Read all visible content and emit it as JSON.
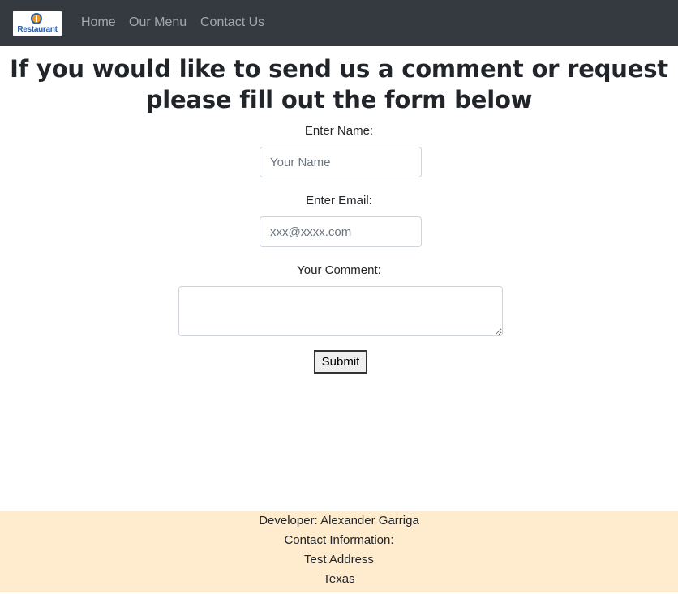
{
  "navbar": {
    "logo_text": "Restaurant",
    "links": [
      {
        "label": "Home"
      },
      {
        "label": "Our Menu"
      },
      {
        "label": "Contact Us"
      }
    ]
  },
  "page": {
    "heading": "If you would like to send us a comment or request please fill out the form below"
  },
  "form": {
    "name_label": "Enter Name:",
    "name_placeholder": "Your Name",
    "name_value": "",
    "email_label": "Enter Email:",
    "email_placeholder": "xxx@xxxx.com",
    "email_value": "",
    "comment_label": "Your Comment:",
    "comment_value": "",
    "submit_label": "Submit"
  },
  "footer": {
    "developer": "Developer: Alexander Garriga",
    "contact": "Contact Information:",
    "address": "Test Address",
    "state": "Texas"
  },
  "colors": {
    "navbar_bg": "#343a40",
    "footer_bg": "#ffebcd",
    "logo_blue": "#2d5fa8",
    "logo_orange": "#f29a1d"
  },
  "icons": {
    "logo": "restaurant-logo-icon"
  }
}
